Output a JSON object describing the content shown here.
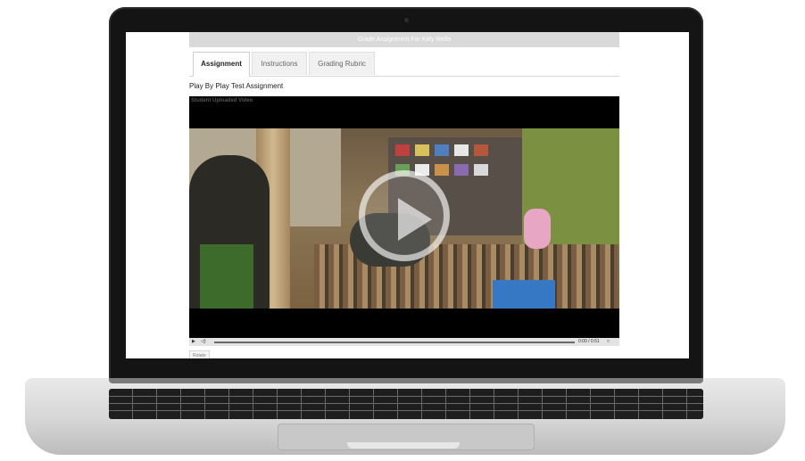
{
  "header": {
    "title": "Grade Assignment For Kitty Wells"
  },
  "tabs": [
    {
      "label": "Assignment",
      "active": true
    },
    {
      "label": "Instructions",
      "active": false
    },
    {
      "label": "Grading Rubric",
      "active": false
    }
  ],
  "assignment": {
    "title": "Play By Play Test Assignment"
  },
  "video": {
    "label": "Student Uploaded Video",
    "current_time": "0:00",
    "duration": "0:51",
    "time_display": "0:00 / 0:51",
    "progress": 0.0
  },
  "controls": {
    "play_icon": "play-icon",
    "volume_icon": "volume-icon",
    "fullscreen_icon": "fullscreen-icon"
  },
  "actions": {
    "rotate_label": "Rotate"
  },
  "colors": {
    "tab_active_bg": "#ffffff",
    "header_bg": "#d9d9d9",
    "video_bg": "#000000"
  }
}
